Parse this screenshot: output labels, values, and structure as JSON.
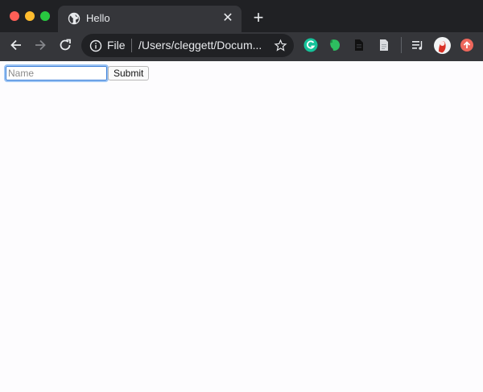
{
  "browser": {
    "tab": {
      "title": "Hello",
      "favicon": "globe-icon",
      "close_icon": "close-icon"
    },
    "new_tab_icon": "plus-icon",
    "navigation": {
      "back_icon": "arrow-left-icon",
      "forward_icon": "arrow-right-icon",
      "reload_icon": "reload-icon"
    },
    "omnibox": {
      "security_icon": "info-icon",
      "scheme_label": "File",
      "url": "/Users/cleggett/Docum...",
      "bookmark_icon": "star-icon"
    },
    "extensions": [
      "grammarly-icon",
      "evernote-icon",
      "document-icon",
      "file-icon",
      "media-controls-icon",
      "profile-avatar",
      "update-icon"
    ],
    "colors": {
      "tabstrip": "#202124",
      "toolbar": "#35363a",
      "accent_grammarly": "#15c39a",
      "accent_evernote": "#2dbe60",
      "update": "#ee675c"
    }
  },
  "page": {
    "form": {
      "name_placeholder": "Name",
      "name_value": "",
      "submit_label": "Submit"
    }
  }
}
